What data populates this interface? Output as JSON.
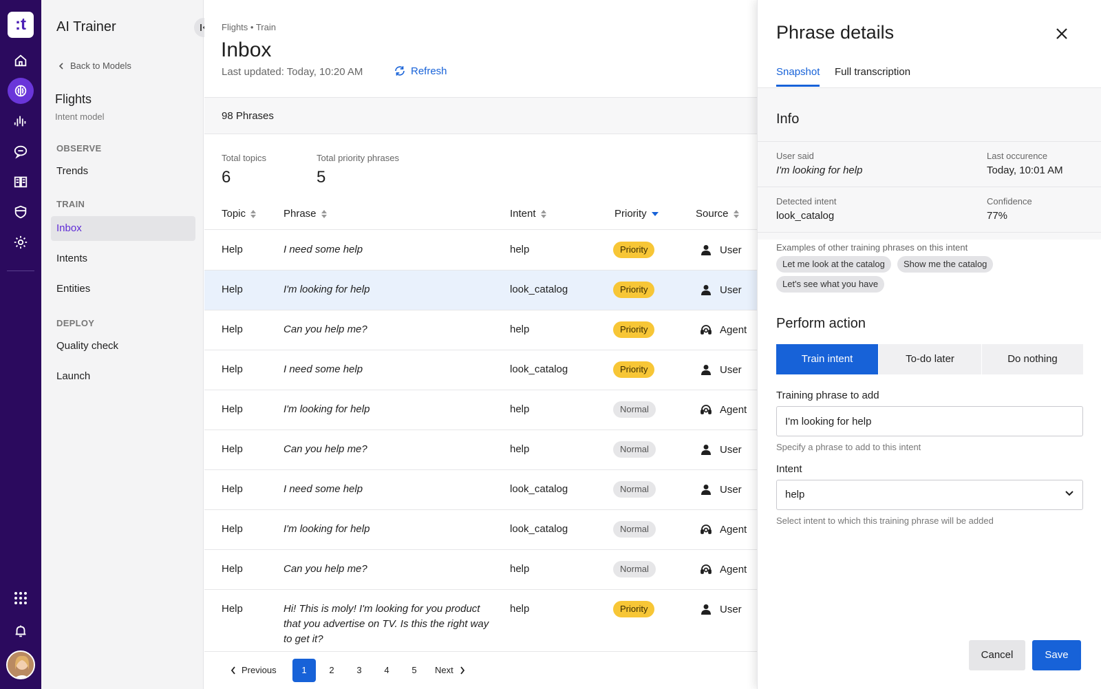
{
  "rail": {
    "logo_text": ":t",
    "icons": [
      "home-icon",
      "brain-icon",
      "waveform-icon",
      "chat-bubble-icon",
      "book-icon",
      "shield-icon",
      "gear-icon"
    ],
    "bottom_icons": [
      "apps-grid-icon",
      "bell-icon"
    ],
    "active_color": "#6a36d9",
    "bg_color": "#2b0a5e"
  },
  "sidebar": {
    "title": "AI Trainer",
    "back_label": "Back to Models",
    "model_name": "Flights",
    "model_sub": "Intent model",
    "sections": [
      {
        "label": "OBSERVE",
        "items": [
          "Trends"
        ]
      },
      {
        "label": "TRAIN",
        "items": [
          "Inbox",
          "Intents",
          "Entities"
        ]
      },
      {
        "label": "DEPLOY",
        "items": [
          "Quality check",
          "Launch"
        ]
      }
    ],
    "active_item": "Inbox"
  },
  "main": {
    "breadcrumb": "Flights • Train",
    "title": "Inbox",
    "last_updated": "Last updated: Today, 10:20 AM",
    "refresh_label": "Refresh",
    "phrases_count": "98 Phrases",
    "stats": [
      {
        "label": "Total topics",
        "value": "6"
      },
      {
        "label": "Total priority phrases",
        "value": "5"
      }
    ],
    "columns": [
      "Topic",
      "Phrase",
      "Intent",
      "Priority",
      "Source"
    ],
    "rows": [
      {
        "topic": "Help",
        "phrase": "I need some help",
        "intent": "help",
        "priority": "Priority",
        "source": "User"
      },
      {
        "topic": "Help",
        "phrase": "I'm looking for help",
        "intent": "look_catalog",
        "priority": "Priority",
        "source": "User"
      },
      {
        "topic": "Help",
        "phrase": "Can you help me?",
        "intent": "help",
        "priority": "Priority",
        "source": "Agent"
      },
      {
        "topic": "Help",
        "phrase": "I need some help",
        "intent": "look_catalog",
        "priority": "Priority",
        "source": "User"
      },
      {
        "topic": "Help",
        "phrase": "I'm looking for help",
        "intent": "help",
        "priority": "Normal",
        "source": "Agent"
      },
      {
        "topic": "Help",
        "phrase": "Can you help me?",
        "intent": "help",
        "priority": "Normal",
        "source": "User"
      },
      {
        "topic": "Help",
        "phrase": "I need some help",
        "intent": "look_catalog",
        "priority": "Normal",
        "source": "User"
      },
      {
        "topic": "Help",
        "phrase": "I'm looking for help",
        "intent": "look_catalog",
        "priority": "Normal",
        "source": "Agent"
      },
      {
        "topic": "Help",
        "phrase": "Can you help me?",
        "intent": "help",
        "priority": "Normal",
        "source": "Agent"
      },
      {
        "topic": "Help",
        "phrase": "Hi! This is moly! I'm looking for you product that you advertise on TV. Is this the right way to get it?",
        "intent": "help",
        "priority": "Priority",
        "source": "User"
      }
    ],
    "selected_row_index": 1,
    "pager": {
      "previous": "Previous",
      "next": "Next",
      "pages": [
        "1",
        "2",
        "3",
        "4",
        "5"
      ],
      "current": "1"
    }
  },
  "panel": {
    "title": "Phrase details",
    "tabs": [
      "Snapshot",
      "Full transcription"
    ],
    "active_tab": "Snapshot",
    "info_title": "Info",
    "user_said_label": "User said",
    "user_said": "I'm looking for help",
    "last_occurence_label": "Last occurence",
    "last_occurence": "Today, 10:01 AM",
    "detected_intent_label": "Detected intent",
    "detected_intent": "look_catalog",
    "confidence_label": "Confidence",
    "confidence": "77%",
    "examples_label": "Examples of other training phrases on this intent",
    "examples": [
      "Let me look at the catalog",
      "Show me the catalog",
      "Let's see what you have"
    ],
    "perform_title": "Perform action",
    "actions": [
      "Train intent",
      "To-do later",
      "Do nothing"
    ],
    "active_action": "Train intent",
    "training_label": "Training phrase to add",
    "training_value": "I'm looking for help",
    "training_help": "Specify a phrase to add to this intent",
    "intent_label": "Intent",
    "intent_value": "help",
    "intent_help": "Select intent to which this training phrase will be added",
    "cancel_label": "Cancel",
    "save_label": "Save"
  },
  "colors": {
    "accent_blue": "#1762d8",
    "priority_yellow": "#f7c636",
    "active_purple": "#5f2bd6",
    "selected_row": "#e9f1fc"
  }
}
